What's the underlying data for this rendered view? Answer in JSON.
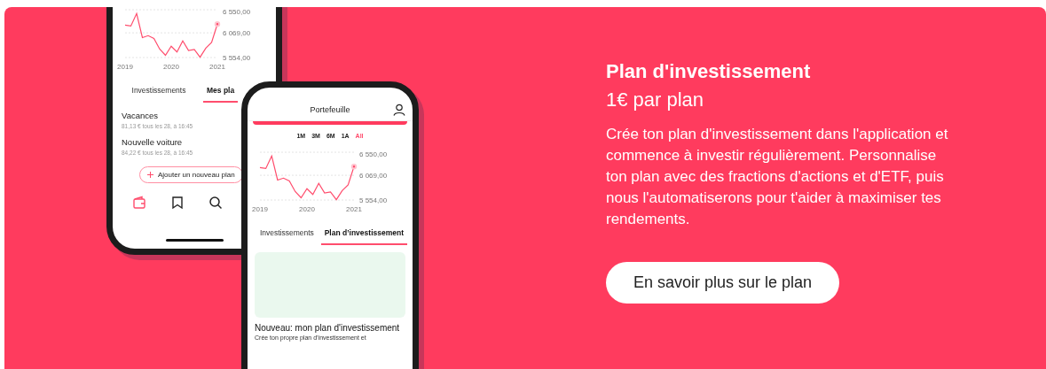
{
  "phones": [
    {
      "kind": "plans",
      "chart_data": {
        "type": "line",
        "x": [
          2019,
          2019.125,
          2019.25,
          2019.375,
          2019.5,
          2019.625,
          2019.75,
          2019.875,
          2020,
          2020.125,
          2020.25,
          2020.375,
          2020.5,
          2020.625,
          2020.75,
          2020.875,
          2021
        ],
        "series": [
          {
            "color": "#ff4d6d",
            "values": [
              6230,
              6210,
              6470,
              5970,
              6010,
              5950,
              5730,
              5600,
              5790,
              5670,
              5900,
              5700,
              5720,
              5560,
              5750,
              5870,
              6250
            ]
          }
        ],
        "xticks": [
          {
            "value": 2019,
            "label": "2019"
          },
          {
            "value": 2020,
            "label": "2020"
          },
          {
            "value": 2021,
            "label": "2021"
          }
        ],
        "yticks": [
          {
            "value": 6550,
            "label": "6 550,00"
          },
          {
            "value": 6069,
            "label": "6 069,00"
          },
          {
            "value": 5554,
            "label": "5 554,00"
          }
        ],
        "xlim": [
          2019,
          2021
        ],
        "ylim": [
          5554,
          6550
        ]
      },
      "tabs": [
        {
          "label": "Investissements",
          "selected": false
        },
        {
          "label": "Mes pla",
          "selected": true
        }
      ],
      "plans": [
        {
          "name": "Vacances",
          "detail": "81,13 € tous les 28, à 16:45"
        },
        {
          "name": "Nouvelle voiture",
          "detail": "84,22 € tous les 28, à 16:45"
        }
      ],
      "add_button": "Ajouter un nouveau plan",
      "nav": [
        {
          "kind": "wallet",
          "selected": true
        },
        {
          "kind": "bookmark",
          "selected": false
        },
        {
          "kind": "search",
          "selected": false
        }
      ]
    },
    {
      "kind": "portfolio",
      "header": "Portefeuille",
      "periods": [
        {
          "label": "1M",
          "selected": false
        },
        {
          "label": "3M",
          "selected": false
        },
        {
          "label": "6M",
          "selected": false
        },
        {
          "label": "1A",
          "selected": false
        },
        {
          "label": "All",
          "selected": true
        }
      ],
      "chart_data": {
        "type": "line",
        "x": [
          2019,
          2019.125,
          2019.25,
          2019.375,
          2019.5,
          2019.625,
          2019.75,
          2019.875,
          2020,
          2020.125,
          2020.25,
          2020.375,
          2020.5,
          2020.625,
          2020.75,
          2020.875,
          2021
        ],
        "series": [
          {
            "color": "#ff4d6d",
            "values": [
              6230,
              6210,
              6470,
              5970,
              6010,
              5950,
              5730,
              5600,
              5790,
              5670,
              5900,
              5700,
              5720,
              5560,
              5750,
              5870,
              6250
            ]
          }
        ],
        "xticks": [
          {
            "value": 2019,
            "label": "2019"
          },
          {
            "value": 2020,
            "label": "2020"
          },
          {
            "value": 2021,
            "label": "2021"
          }
        ],
        "yticks": [
          {
            "value": 6550,
            "label": "6 550,00"
          },
          {
            "value": 6069,
            "label": "6 069,00"
          },
          {
            "value": 5554,
            "label": "5 554,00"
          }
        ],
        "xlim": [
          2019,
          2021
        ],
        "ylim": [
          5554,
          6550
        ]
      },
      "tabs": [
        {
          "label": "Investissements",
          "selected": false
        },
        {
          "label": "Plan d’investissement",
          "selected": true
        }
      ],
      "card_title": "Nouveau: mon plan d'investissement",
      "card_text": "Crée ton propre plan d’investissement et"
    }
  ],
  "panel": {
    "title": "Plan d'investissement",
    "subtitle": "1€ par plan",
    "body": "Crée ton plan d'investissement dans l'application et commence à investir régulièrement. Personnalise ton plan avec des fractions d'actions et d'ETF, puis nous l'automatiserons pour t'aider à maximiser tes rendements.",
    "button": "En savoir plus sur le plan"
  }
}
